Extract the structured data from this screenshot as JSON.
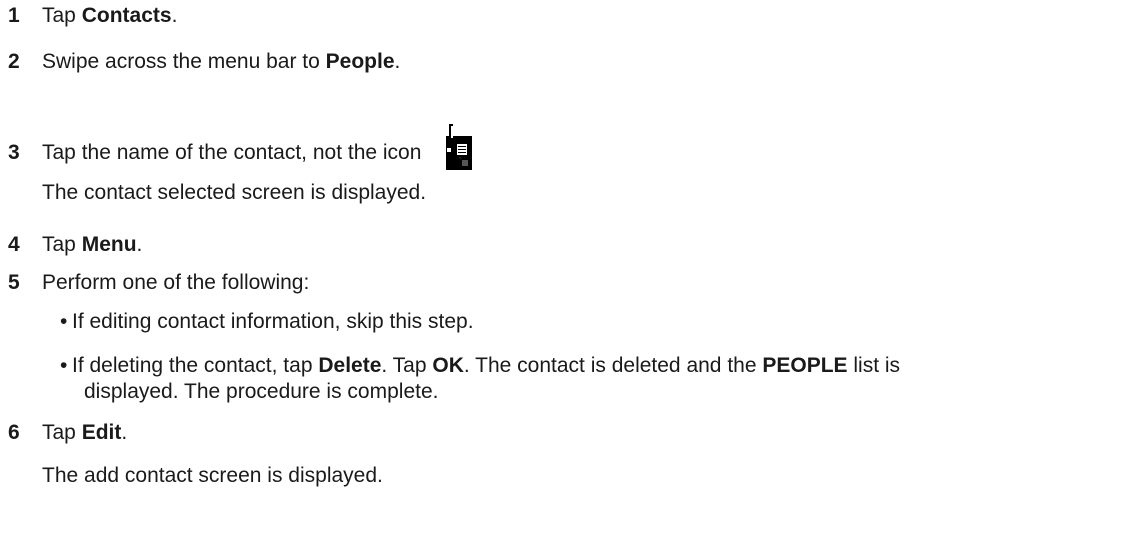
{
  "steps": [
    {
      "num": "1",
      "pre": "Tap ",
      "bold": "Contacts",
      "post": "."
    },
    {
      "num": "2",
      "pre": "Swipe across the menu bar to ",
      "bold": "People",
      "post": "."
    },
    {
      "num": "3",
      "pre": "Tap the name of the contact, not the icon",
      "post": " ."
    },
    {
      "num": "4",
      "pre": "Tap ",
      "bold": "Menu",
      "post": "."
    },
    {
      "num": "5",
      "pre": "Perform one of the following:"
    },
    {
      "num": "6",
      "pre": "Tap ",
      "bold": "Edit",
      "post": "."
    }
  ],
  "step3_result": "The contact selected screen is displayed.",
  "step6_result": "The add contact screen is displayed.",
  "bullet_char": "•",
  "bullets": {
    "b1": {
      "text": "If editing contact information, skip this step."
    },
    "b2": {
      "t1": "If deleting the contact, tap ",
      "b1": "Delete",
      "t2": ". Tap ",
      "b2": "OK",
      "t3": ". The contact is deleted and the ",
      "b3": "PEOPLE",
      "t4": " list is",
      "line2": "displayed. The procedure is complete."
    }
  },
  "icon": "radio-contact-icon"
}
